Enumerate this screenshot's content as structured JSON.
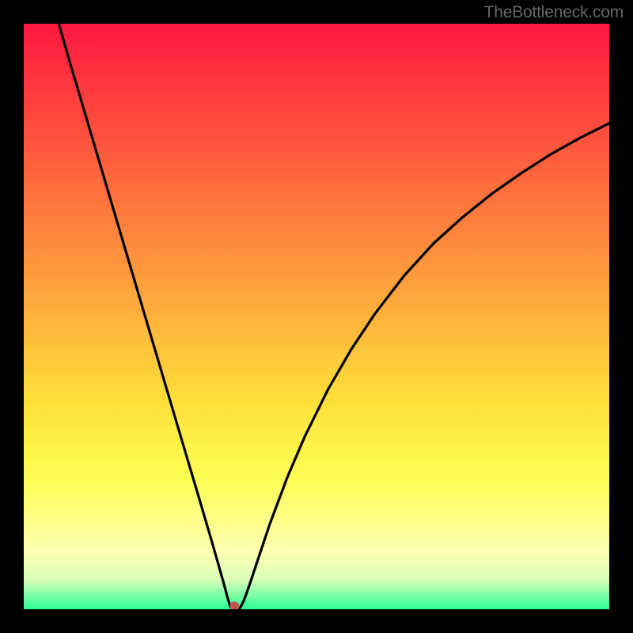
{
  "watermark": "TheBottleneck.com",
  "chart_data": {
    "type": "line",
    "title": "",
    "xlabel": "",
    "ylabel": "",
    "xlim": [
      0,
      100
    ],
    "ylim": [
      0,
      100
    ],
    "gradient_stops": [
      {
        "offset": 0,
        "color": "#ff183f"
      },
      {
        "offset": 22,
        "color": "#ff5a3e"
      },
      {
        "offset": 45,
        "color": "#ffa23c"
      },
      {
        "offset": 65,
        "color": "#ffe13a"
      },
      {
        "offset": 78,
        "color": "#ffff55"
      },
      {
        "offset": 90,
        "color": "#feffb0"
      },
      {
        "offset": 95,
        "color": "#d9ffb8"
      },
      {
        "offset": 100,
        "color": "#29ff94"
      }
    ],
    "curve_points": [
      {
        "x": 6.0,
        "y": 100.0
      },
      {
        "x": 8.0,
        "y": 93.0
      },
      {
        "x": 12.0,
        "y": 79.5
      },
      {
        "x": 16.0,
        "y": 66.0
      },
      {
        "x": 20.0,
        "y": 52.5
      },
      {
        "x": 24.0,
        "y": 39.0
      },
      {
        "x": 28.0,
        "y": 25.5
      },
      {
        "x": 30.0,
        "y": 18.8
      },
      {
        "x": 32.0,
        "y": 12.0
      },
      {
        "x": 33.0,
        "y": 8.5
      },
      {
        "x": 34.0,
        "y": 5.0
      },
      {
        "x": 34.8,
        "y": 2.0
      },
      {
        "x": 35.3,
        "y": 0.4
      },
      {
        "x": 35.8,
        "y": 0.0
      },
      {
        "x": 36.5,
        "y": 0.0
      },
      {
        "x": 37.0,
        "y": 0.3
      },
      {
        "x": 37.6,
        "y": 1.5
      },
      {
        "x": 38.5,
        "y": 4.0
      },
      {
        "x": 40.0,
        "y": 8.5
      },
      {
        "x": 42.0,
        "y": 14.5
      },
      {
        "x": 45.0,
        "y": 22.5
      },
      {
        "x": 48.0,
        "y": 29.5
      },
      {
        "x": 52.0,
        "y": 37.6
      },
      {
        "x": 56.0,
        "y": 44.5
      },
      {
        "x": 60.0,
        "y": 50.5
      },
      {
        "x": 65.0,
        "y": 57.0
      },
      {
        "x": 70.0,
        "y": 62.5
      },
      {
        "x": 75.0,
        "y": 67.0
      },
      {
        "x": 80.0,
        "y": 71.0
      },
      {
        "x": 85.0,
        "y": 74.5
      },
      {
        "x": 90.0,
        "y": 77.7
      },
      {
        "x": 95.0,
        "y": 80.5
      },
      {
        "x": 100.0,
        "y": 83.0
      }
    ],
    "marker": {
      "x": 36.0,
      "y": 0.5,
      "color": "#c0544f",
      "radius": 6
    }
  }
}
